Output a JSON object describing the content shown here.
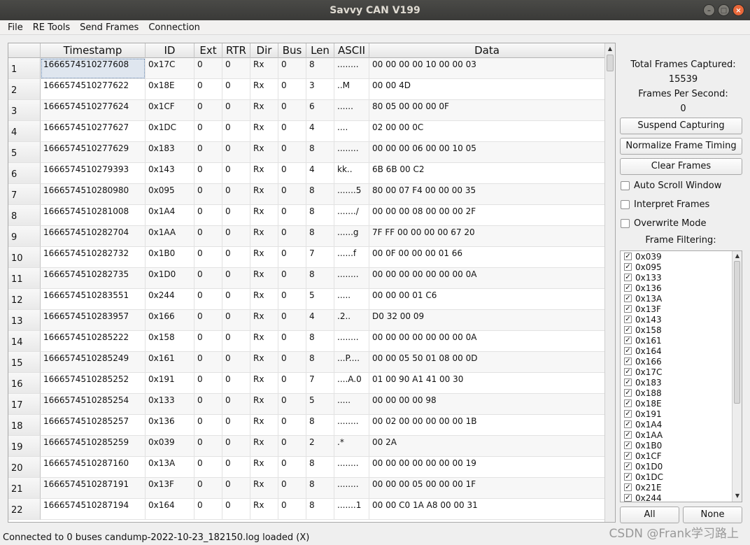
{
  "window": {
    "title": "Savvy CAN V199"
  },
  "menu": [
    "File",
    "RE Tools",
    "Send Frames",
    "Connection"
  ],
  "table": {
    "columns": [
      "",
      "Timestamp",
      "ID",
      "Ext",
      "RTR",
      "Dir",
      "Bus",
      "Len",
      "ASCII",
      "Data"
    ],
    "rows": [
      [
        "1",
        "1666574510277608",
        "0x17C",
        "0",
        "0",
        "Rx",
        "0",
        "8",
        "........",
        "00 00 00 00 10 00 00 03"
      ],
      [
        "2",
        "1666574510277622",
        "0x18E",
        "0",
        "0",
        "Rx",
        "0",
        "3",
        "..M",
        "00 00 4D"
      ],
      [
        "3",
        "1666574510277624",
        "0x1CF",
        "0",
        "0",
        "Rx",
        "0",
        "6",
        "......",
        "80 05 00 00 00 0F"
      ],
      [
        "4",
        "1666574510277627",
        "0x1DC",
        "0",
        "0",
        "Rx",
        "0",
        "4",
        "....",
        "02 00 00 0C"
      ],
      [
        "5",
        "1666574510277629",
        "0x183",
        "0",
        "0",
        "Rx",
        "0",
        "8",
        "........",
        "00 00 00 06 00 00 10 05"
      ],
      [
        "6",
        "1666574510279393",
        "0x143",
        "0",
        "0",
        "Rx",
        "0",
        "4",
        "kk..",
        "6B 6B 00 C2"
      ],
      [
        "7",
        "1666574510280980",
        "0x095",
        "0",
        "0",
        "Rx",
        "0",
        "8",
        ".......5",
        "80 00 07 F4 00 00 00 35"
      ],
      [
        "8",
        "1666574510281008",
        "0x1A4",
        "0",
        "0",
        "Rx",
        "0",
        "8",
        "......./",
        "00 00 00 08 00 00 00 2F"
      ],
      [
        "9",
        "1666574510282704",
        "0x1AA",
        "0",
        "0",
        "Rx",
        "0",
        "8",
        "......g",
        "7F FF 00 00 00 00 67 20"
      ],
      [
        "10",
        "1666574510282732",
        "0x1B0",
        "0",
        "0",
        "Rx",
        "0",
        "7",
        "......f",
        "00 0F 00 00 00 01 66"
      ],
      [
        "11",
        "1666574510282735",
        "0x1D0",
        "0",
        "0",
        "Rx",
        "0",
        "8",
        "........",
        "00 00 00 00 00 00 00 0A"
      ],
      [
        "12",
        "1666574510283551",
        "0x244",
        "0",
        "0",
        "Rx",
        "0",
        "5",
        ".....",
        "00 00 00 01 C6"
      ],
      [
        "13",
        "1666574510283957",
        "0x166",
        "0",
        "0",
        "Rx",
        "0",
        "4",
        ".2..",
        "D0 32 00 09"
      ],
      [
        "14",
        "1666574510285222",
        "0x158",
        "0",
        "0",
        "Rx",
        "0",
        "8",
        "........",
        "00 00 00 00 00 00 00 0A"
      ],
      [
        "15",
        "1666574510285249",
        "0x161",
        "0",
        "0",
        "Rx",
        "0",
        "8",
        "...P....",
        "00 00 05 50 01 08 00 0D"
      ],
      [
        "16",
        "1666574510285252",
        "0x191",
        "0",
        "0",
        "Rx",
        "0",
        "7",
        "....A.0",
        "01 00 90 A1 41 00 30"
      ],
      [
        "17",
        "1666574510285254",
        "0x133",
        "0",
        "0",
        "Rx",
        "0",
        "5",
        ".....",
        "00 00 00 00 98"
      ],
      [
        "18",
        "1666574510285257",
        "0x136",
        "0",
        "0",
        "Rx",
        "0",
        "8",
        "........",
        "00 02 00 00 00 00 00 1B"
      ],
      [
        "19",
        "1666574510285259",
        "0x039",
        "0",
        "0",
        "Rx",
        "0",
        "2",
        ".*",
        "00 2A"
      ],
      [
        "20",
        "1666574510287160",
        "0x13A",
        "0",
        "0",
        "Rx",
        "0",
        "8",
        "........",
        "00 00 00 00 00 00 00 19"
      ],
      [
        "21",
        "1666574510287191",
        "0x13F",
        "0",
        "0",
        "Rx",
        "0",
        "8",
        "........",
        "00 00 00 05 00 00 00 1F"
      ],
      [
        "22",
        "1666574510287194",
        "0x164",
        "0",
        "0",
        "Rx",
        "0",
        "8",
        ".......1",
        "00 00 C0 1A A8 00 00 31"
      ]
    ]
  },
  "stats": {
    "total_label": "Total Frames Captured:",
    "total_value": "15539",
    "fps_label": "Frames Per Second:",
    "fps_value": "0"
  },
  "buttons": {
    "suspend": "Suspend Capturing",
    "normalize": "Normalize Frame Timing",
    "clear": "Clear Frames",
    "all": "All",
    "none": "None"
  },
  "checkboxes": {
    "auto_scroll": "Auto Scroll Window",
    "interpret": "Interpret Frames",
    "overwrite": "Overwrite Mode"
  },
  "filter": {
    "label": "Frame Filtering:",
    "items": [
      "0x039",
      "0x095",
      "0x133",
      "0x136",
      "0x13A",
      "0x13F",
      "0x143",
      "0x158",
      "0x161",
      "0x164",
      "0x166",
      "0x17C",
      "0x183",
      "0x188",
      "0x18E",
      "0x191",
      "0x1A4",
      "0x1AA",
      "0x1B0",
      "0x1CF",
      "0x1D0",
      "0x1DC",
      "0x21E",
      "0x244"
    ],
    "check_mark": "✓"
  },
  "status": "Connected to 0 buses  candump-2022-10-23_182150.log loaded (X)",
  "watermark": "CSDN @Frank学习路上"
}
